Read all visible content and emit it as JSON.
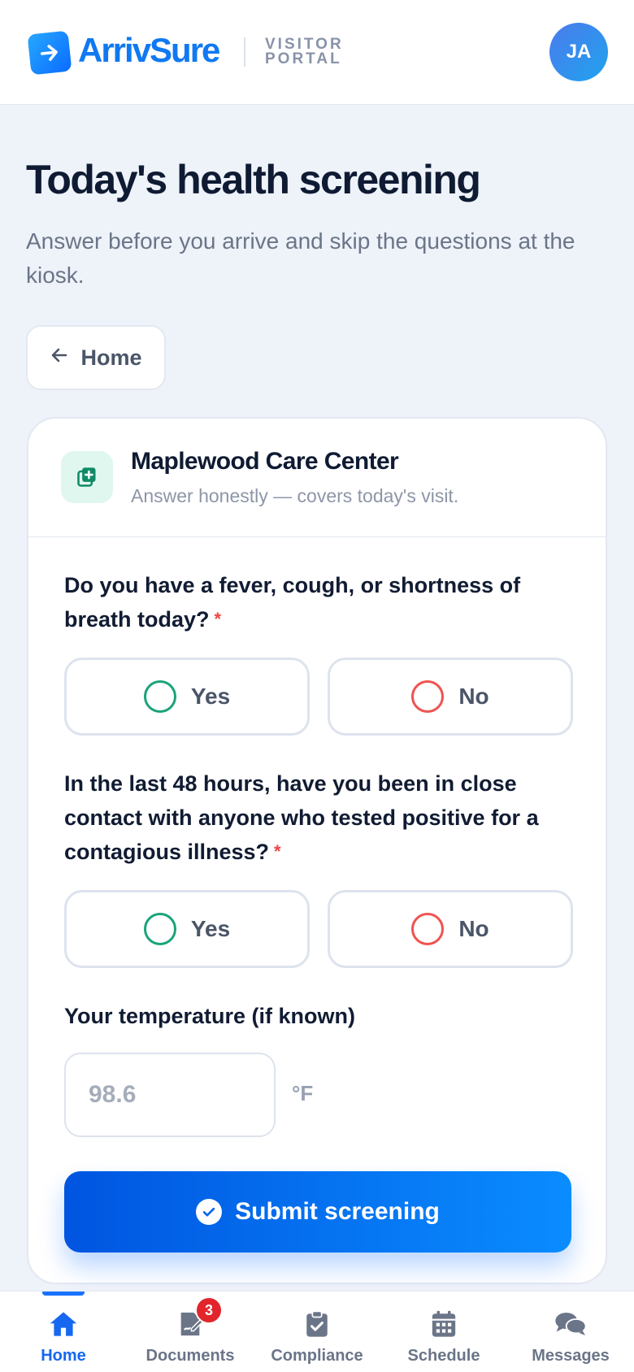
{
  "brand": {
    "name": "ArrivSure",
    "portal_line1": "VISITOR",
    "portal_line2": "PORTAL",
    "accent": "#1079f2"
  },
  "user": {
    "initials": "JA"
  },
  "page": {
    "title": "Today's health screening",
    "subtitle": "Answer before you arrive and skip the questions at the kiosk.",
    "back_label": "Home"
  },
  "facility": {
    "name": "Maplewood Care Center",
    "note": "Answer honestly — covers today's visit."
  },
  "questions": [
    {
      "label": "Do you have a fever, cough, or shortness of breath today?",
      "required_mark": "*",
      "yes": "Yes",
      "no": "No"
    },
    {
      "label": "In the last 48 hours, have you been in close contact with anyone who tested positive for a contagious illness?",
      "required_mark": "*",
      "yes": "Yes",
      "no": "No"
    }
  ],
  "temperature": {
    "label": "Your temperature (if known)",
    "placeholder": "98.6",
    "value": "",
    "unit": "°F"
  },
  "submit": {
    "label": "Submit screening"
  },
  "nav": {
    "items": [
      {
        "label": "Home",
        "icon": "home-icon",
        "active": true
      },
      {
        "label": "Documents",
        "icon": "document-sign-icon",
        "badge": "3"
      },
      {
        "label": "Compliance",
        "icon": "clipboard-check-icon"
      },
      {
        "label": "Schedule",
        "icon": "calendar-icon"
      },
      {
        "label": "Messages",
        "icon": "chat-bubbles-icon"
      }
    ]
  },
  "colors": {
    "yes_radio": "#1aa37a",
    "no_radio": "#ef5350",
    "required": "#ef4444",
    "badge": "#e1252b"
  }
}
